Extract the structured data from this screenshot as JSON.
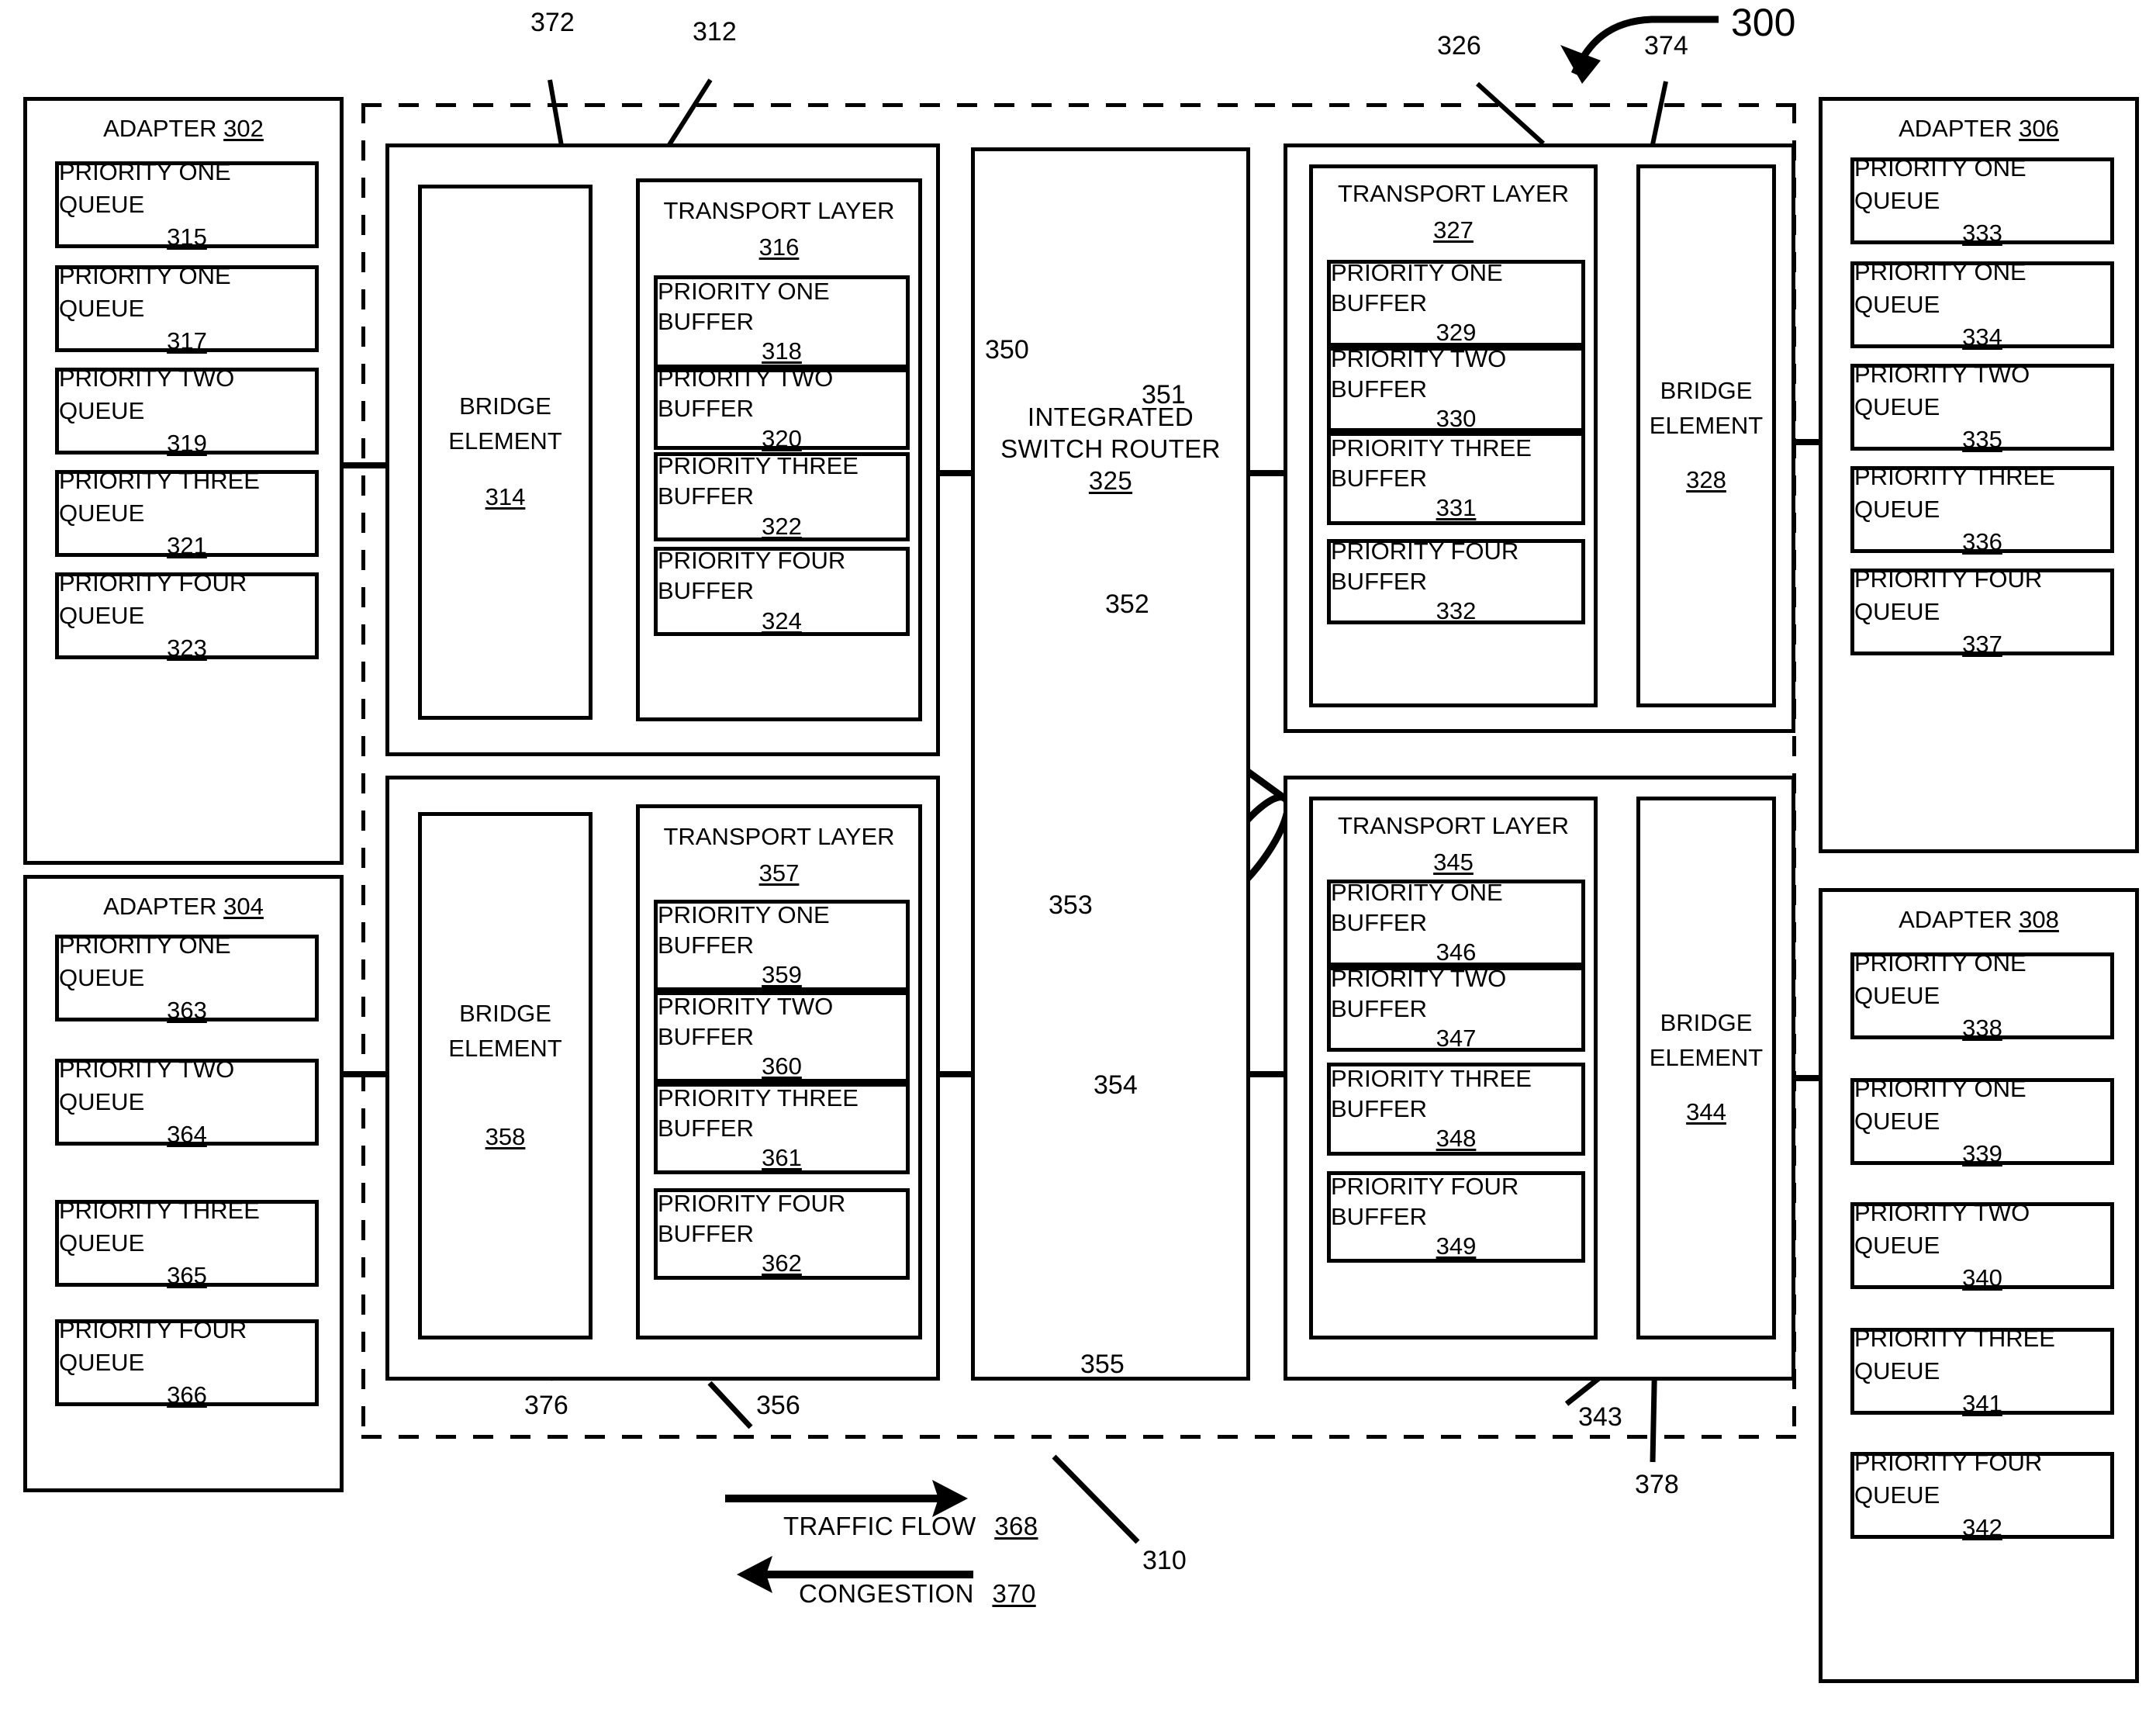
{
  "figure": {
    "figure_ref": "300",
    "domain_ref": "310",
    "title_hidden": ""
  },
  "legend": {
    "traffic_flow_label": "TRAFFIC FLOW",
    "traffic_flow_ref": "368",
    "congestion_label": "CONGESTION",
    "congestion_ref": "370"
  },
  "callouts": {
    "c372": "372",
    "c312": "312",
    "c326": "326",
    "c374": "374",
    "c300": "300",
    "c310": "310",
    "c350": "350",
    "c351": "351",
    "c352": "352",
    "c353": "353",
    "c354": "354",
    "c355": "355",
    "c376": "376",
    "c356": "356",
    "c343": "343",
    "c378": "378"
  },
  "adapters": [
    {
      "id": "adapter-302",
      "title": "ADAPTER",
      "ref": "302",
      "queues": [
        {
          "label": "PRIORITY ONE QUEUE",
          "ref": "315"
        },
        {
          "label": "PRIORITY ONE QUEUE",
          "ref": "317"
        },
        {
          "label": "PRIORITY TWO QUEUE",
          "ref": "319"
        },
        {
          "label": "PRIORITY THREE QUEUE",
          "ref": "321"
        },
        {
          "label": "PRIORITY FOUR QUEUE",
          "ref": "323"
        }
      ]
    },
    {
      "id": "adapter-304",
      "title": "ADAPTER",
      "ref": "304",
      "queues": [
        {
          "label": "PRIORITY ONE QUEUE",
          "ref": "363"
        },
        {
          "label": "PRIORITY TWO QUEUE",
          "ref": "364"
        },
        {
          "label": "PRIORITY THREE QUEUE",
          "ref": "365"
        },
        {
          "label": "PRIORITY FOUR QUEUE",
          "ref": "366"
        }
      ]
    },
    {
      "id": "adapter-306",
      "title": "ADAPTER",
      "ref": "306",
      "queues": [
        {
          "label": "PRIORITY ONE QUEUE",
          "ref": "333"
        },
        {
          "label": "PRIORITY ONE QUEUE",
          "ref": "334"
        },
        {
          "label": "PRIORITY TWO QUEUE",
          "ref": "335"
        },
        {
          "label": "PRIORITY THREE QUEUE",
          "ref": "336"
        },
        {
          "label": "PRIORITY FOUR QUEUE",
          "ref": "337"
        }
      ]
    },
    {
      "id": "adapter-308",
      "title": "ADAPTER",
      "ref": "308",
      "queues": [
        {
          "label": "PRIORITY ONE QUEUE",
          "ref": "338"
        },
        {
          "label": "PRIORITY ONE QUEUE",
          "ref": "339"
        },
        {
          "label": "PRIORITY TWO QUEUE",
          "ref": "340"
        },
        {
          "label": "PRIORITY THREE QUEUE",
          "ref": "341"
        },
        {
          "label": "PRIORITY FOUR QUEUE",
          "ref": "342"
        }
      ]
    }
  ],
  "nodes": [
    {
      "id": "node-top-left",
      "node_ref": "312",
      "bridge": {
        "line1": "BRIDGE",
        "line2": "ELEMENT",
        "ref": "314"
      },
      "transport": {
        "label": "TRANSPORT LAYER",
        "ref": "316"
      },
      "buffers": [
        {
          "label": "PRIORITY ONE BUFFER",
          "ref": "318"
        },
        {
          "label": "PRIORITY TWO BUFFER",
          "ref": "320"
        },
        {
          "label": "PRIORITY THREE BUFFER",
          "label2": "BUFFER",
          "ref": "322"
        },
        {
          "label": "PRIORITY FOUR BUFFER",
          "ref": "324"
        }
      ]
    },
    {
      "id": "node-bottom-left",
      "node_ref": "356",
      "bridge": {
        "line1": "BRIDGE",
        "line2": "ELEMENT",
        "ref": "358"
      },
      "transport": {
        "label": "TRANSPORT LAYER",
        "ref": "357"
      },
      "buffers": [
        {
          "label": "PRIORITY ONE BUFFER",
          "ref": "359"
        },
        {
          "label": "PRIORITY TWO BUFFER",
          "ref": "360"
        },
        {
          "label": "PRIORITY THREE BUFFER",
          "label2": "BUFFER",
          "ref": "361"
        },
        {
          "label": "PRIORITY FOUR BUFFER",
          "ref": "362"
        }
      ]
    },
    {
      "id": "node-top-right",
      "node_ref": "326",
      "bridge": {
        "line1": "BRIDGE",
        "line2": "ELEMENT",
        "ref": "328"
      },
      "transport": {
        "label": "TRANSPORT LAYER",
        "ref": "327"
      },
      "buffers": [
        {
          "label": "PRIORITY ONE BUFFER",
          "ref": "329"
        },
        {
          "label": "PRIORITY TWO BUFFER",
          "ref": "330"
        },
        {
          "label": "PRIORITY THREE BUFFER",
          "label2": "BUFFER",
          "ref": "331"
        },
        {
          "label": "PRIORITY FOUR BUFFER",
          "ref": "332"
        }
      ]
    },
    {
      "id": "node-bottom-right",
      "node_ref": "343",
      "bridge": {
        "line1": "BRIDGE",
        "line2": "ELEMENT",
        "ref": "344"
      },
      "transport": {
        "label": "TRANSPORT LAYER",
        "ref": "345"
      },
      "buffers": [
        {
          "label": "PRIORITY ONE BUFFER",
          "ref": "346"
        },
        {
          "label": "PRIORITY TWO BUFFER",
          "ref": "347"
        },
        {
          "label": "PRIORITY THREE BUFFER",
          "label2": "BUFFER",
          "ref": "348"
        },
        {
          "label": "PRIORITY FOUR BUFFER",
          "ref": "349"
        }
      ]
    }
  ],
  "switch_router": {
    "line1": "INTEGRATED",
    "line2": "SWITCH ROUTER",
    "ref": "325",
    "links": [
      {
        "ref": "350",
        "detail_ref": "351"
      },
      {
        "ref": "352",
        "detail_ref": "353"
      },
      {
        "ref": "354",
        "detail_ref": "355"
      }
    ]
  },
  "text_strings": {
    "bridge_line1": "BRIDGE",
    "bridge_line2": "ELEMENT",
    "transport_layer": "TRANSPORT LAYER",
    "adapter": "ADAPTER"
  }
}
